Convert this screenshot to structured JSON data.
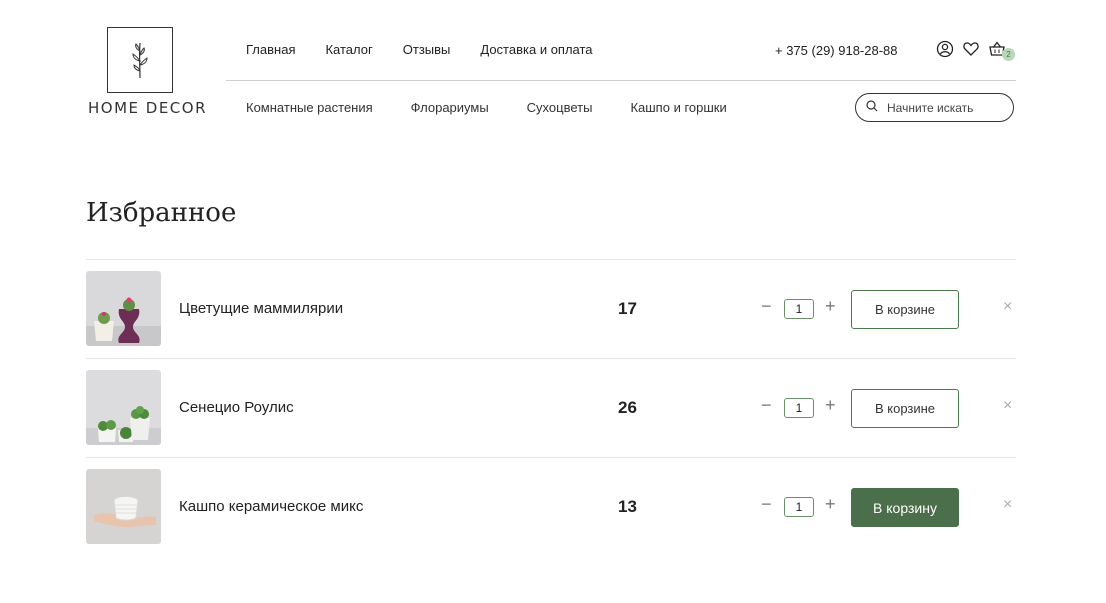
{
  "logo": {
    "text": "HOME DECOR"
  },
  "top_nav": [
    "Главная",
    "Каталог",
    "Отзывы",
    "Доставка и оплата"
  ],
  "phone": "+ 375 (29) 918-28-88",
  "cart_count": "2",
  "category_nav": [
    "Комнатные растения",
    "Флорариумы",
    "Сухоцветы",
    "Кашпо и горшки"
  ],
  "search": {
    "placeholder": "Начните искать"
  },
  "page_title": "Избранное",
  "favorites": [
    {
      "name": "Цветущие маммилярии",
      "price": "17",
      "qty": "1",
      "button": "В корзине",
      "in_cart": true
    },
    {
      "name": "Сенецио Роулис",
      "price": "26",
      "qty": "1",
      "button": "В корзине",
      "in_cart": true
    },
    {
      "name": "Кашпо керамическое микс",
      "price": "13",
      "qty": "1",
      "button": "В корзину",
      "in_cart": false
    }
  ],
  "controls": {
    "minus": "−",
    "plus": "+",
    "remove": "×"
  },
  "colors": {
    "accent": "#4b6e4b",
    "badge": "#b8d8b8"
  },
  "icons": [
    "user-icon",
    "heart-icon",
    "basket-icon",
    "search-icon",
    "close-icon"
  ]
}
